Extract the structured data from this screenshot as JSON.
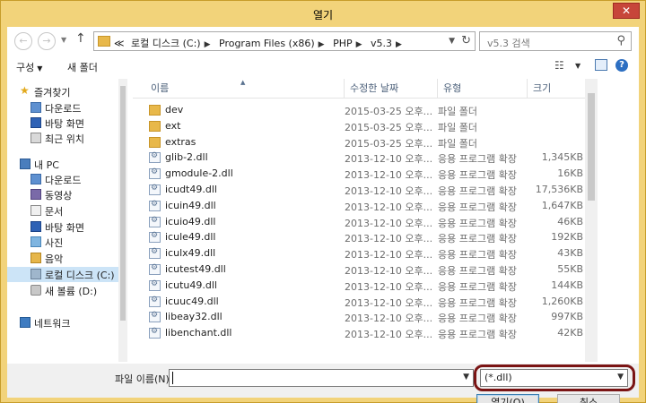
{
  "window": {
    "title": "열기",
    "close_symbol": "✕"
  },
  "nav": {
    "breadcrumbs": [
      "≪",
      "로컬 디스크 (C:)",
      "Program Files (x86)",
      "PHP",
      "v5.3"
    ],
    "search_placeholder": "v5.3 검색"
  },
  "toolbar": {
    "organize_label": "구성",
    "new_folder_label": "새 폴더"
  },
  "navpane": {
    "items": [
      {
        "label": "즐겨찾기",
        "icon": "star-icon",
        "indent": 0
      },
      {
        "label": "다운로드",
        "icon": "downloads-icon",
        "indent": 1
      },
      {
        "label": "바탕 화면",
        "icon": "desktop-icon",
        "indent": 1
      },
      {
        "label": "최근 위치",
        "icon": "recent-icon",
        "indent": 1
      },
      {
        "label": "내 PC",
        "icon": "pc-icon",
        "indent": 0
      },
      {
        "label": "다운로드",
        "icon": "downloads-icon",
        "indent": 1
      },
      {
        "label": "동영상",
        "icon": "video-icon",
        "indent": 1
      },
      {
        "label": "문서",
        "icon": "documents-icon",
        "indent": 1
      },
      {
        "label": "바탕 화면",
        "icon": "desktop-icon",
        "indent": 1
      },
      {
        "label": "사진",
        "icon": "pictures-icon",
        "indent": 1
      },
      {
        "label": "음악",
        "icon": "music-icon",
        "indent": 1
      },
      {
        "label": "로컬 디스크 (C:)",
        "icon": "drive-icon",
        "indent": 1,
        "selected": true
      },
      {
        "label": "새 볼륨 (D:)",
        "icon": "dvd-drive-icon",
        "indent": 1
      },
      {
        "label": "네트워크",
        "icon": "network-icon",
        "indent": 0
      }
    ]
  },
  "filelist": {
    "columns": [
      "이름",
      "수정한 날짜",
      "유형",
      "크기"
    ],
    "rows": [
      {
        "name": "dev",
        "date": "2015-03-25 오후...",
        "type": "파일 폴더",
        "size": "",
        "kind": "folder"
      },
      {
        "name": "ext",
        "date": "2015-03-25 오후...",
        "type": "파일 폴더",
        "size": "",
        "kind": "folder"
      },
      {
        "name": "extras",
        "date": "2015-03-25 오후...",
        "type": "파일 폴더",
        "size": "",
        "kind": "folder"
      },
      {
        "name": "glib-2.dll",
        "date": "2013-12-10 오후...",
        "type": "응용 프로그램 확장",
        "size": "1,345KB",
        "kind": "dll"
      },
      {
        "name": "gmodule-2.dll",
        "date": "2013-12-10 오후...",
        "type": "응용 프로그램 확장",
        "size": "16KB",
        "kind": "dll"
      },
      {
        "name": "icudt49.dll",
        "date": "2013-12-10 오후...",
        "type": "응용 프로그램 확장",
        "size": "17,536KB",
        "kind": "dll"
      },
      {
        "name": "icuin49.dll",
        "date": "2013-12-10 오후...",
        "type": "응용 프로그램 확장",
        "size": "1,647KB",
        "kind": "dll"
      },
      {
        "name": "icuio49.dll",
        "date": "2013-12-10 오후...",
        "type": "응용 프로그램 확장",
        "size": "46KB",
        "kind": "dll"
      },
      {
        "name": "icule49.dll",
        "date": "2013-12-10 오후...",
        "type": "응용 프로그램 확장",
        "size": "192KB",
        "kind": "dll"
      },
      {
        "name": "iculx49.dll",
        "date": "2013-12-10 오후...",
        "type": "응용 프로그램 확장",
        "size": "43KB",
        "kind": "dll"
      },
      {
        "name": "icutest49.dll",
        "date": "2013-12-10 오후...",
        "type": "응용 프로그램 확장",
        "size": "55KB",
        "kind": "dll"
      },
      {
        "name": "icutu49.dll",
        "date": "2013-12-10 오후...",
        "type": "응용 프로그램 확장",
        "size": "144KB",
        "kind": "dll"
      },
      {
        "name": "icuuc49.dll",
        "date": "2013-12-10 오후...",
        "type": "응용 프로그램 확장",
        "size": "1,260KB",
        "kind": "dll"
      },
      {
        "name": "libeay32.dll",
        "date": "2013-12-10 오후...",
        "type": "응용 프로그램 확장",
        "size": "997KB",
        "kind": "dll"
      },
      {
        "name": "libenchant.dll",
        "date": "2013-12-10 오후...",
        "type": "응용 프로그램 확장",
        "size": "42KB",
        "kind": "dll"
      }
    ]
  },
  "bottom": {
    "filename_label": "파일 이름(N):",
    "filename_value": "",
    "filetype_value": "(*.dll)",
    "open_label": "열기(O)",
    "cancel_label": "취소"
  },
  "colors": {
    "title_bar": "#f2d37a",
    "close_button": "#c7463a",
    "highlight_outline": "#7a1414",
    "selection": "#cce4f7"
  }
}
